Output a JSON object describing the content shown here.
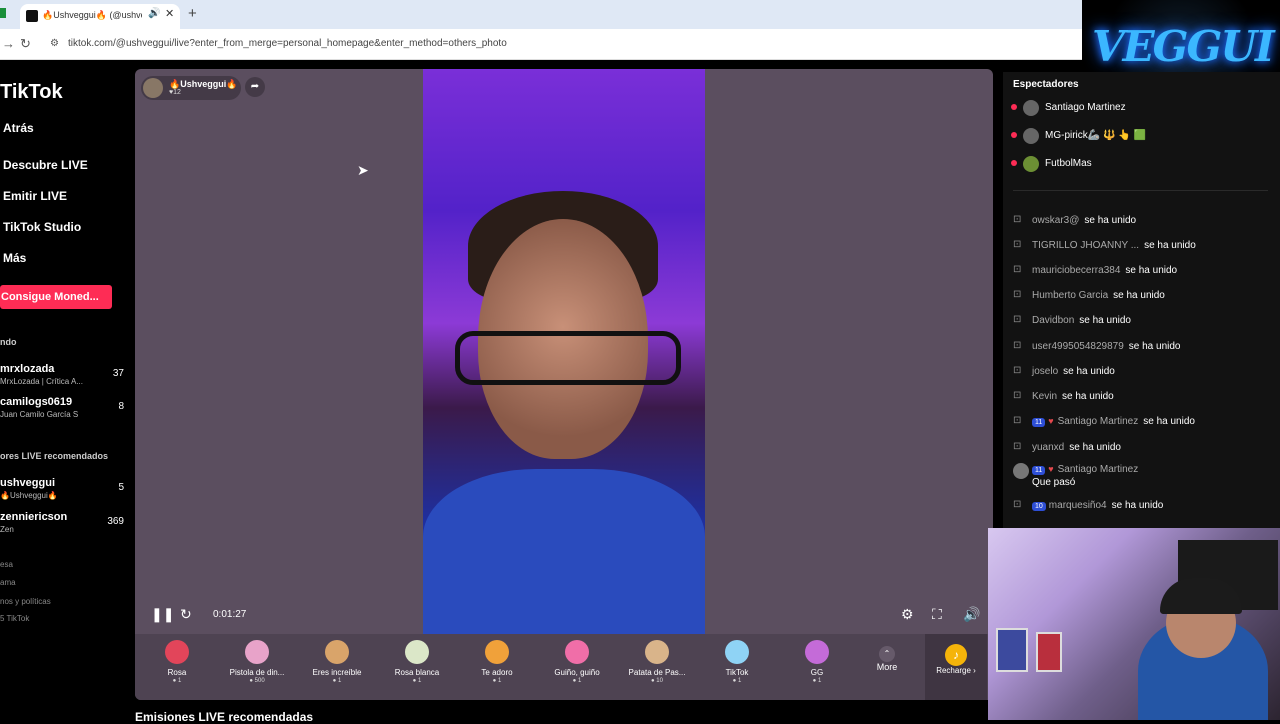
{
  "browser": {
    "tab_title": "🔥Ushveggui🔥 (@ushveg",
    "new_tab": "+",
    "close": "✕",
    "url": "tiktok.com/@ushveggui/live?enter_from_merge=personal_homepage&enter_method=others_photo"
  },
  "overlay_logo": "VEGGUI",
  "sidebar": {
    "brand": "TikTok",
    "nav": [
      "Atrás",
      "Descubre LIVE",
      "Emitir LIVE",
      "TikTok Studio",
      "Más"
    ],
    "coins_button": "Consigue Moned...",
    "following_label": "ndo",
    "following": [
      {
        "name": "mrxlozada",
        "sub": "MrxLozada | Crítica A...",
        "count": "37"
      },
      {
        "name": "camilogs0619",
        "sub": "Juan Camilo García S",
        "count": "8"
      }
    ],
    "recommended_label": "ores LIVE recomendados",
    "recommended": [
      {
        "name": "ushveggui",
        "sub": "🔥Ushveggui🔥",
        "count": "5"
      },
      {
        "name": "zenniericson",
        "sub": "Zen",
        "count": "369"
      }
    ],
    "footer": [
      "esa",
      "ama",
      "nos y políticas",
      "5 TikTok"
    ]
  },
  "player": {
    "streamer_name": "🔥Ushveggui🔥",
    "likes": "♥12",
    "elapsed": "0:01:27",
    "gifts": [
      {
        "name": "Rosa",
        "price": "1",
        "color": "#e2455a"
      },
      {
        "name": "Pistola de din...",
        "price": "500",
        "color": "#e8a3c9"
      },
      {
        "name": "Eres increíble",
        "price": "1",
        "color": "#d9a46a"
      },
      {
        "name": "Rosa blanca",
        "price": "1",
        "color": "#dbe7c8"
      },
      {
        "name": "Te adoro",
        "price": "1",
        "color": "#f0a13a"
      },
      {
        "name": "Guiño, guiño",
        "price": "1",
        "color": "#f06ea8"
      },
      {
        "name": "Patata de Pas...",
        "price": "10",
        "color": "#d9b48a"
      },
      {
        "name": "TikTok",
        "price": "1",
        "color": "#8fd3f5"
      },
      {
        "name": "GG",
        "price": "1",
        "color": "#c46bd8"
      }
    ],
    "more_label": "More",
    "recharge_label": "Recharge ›"
  },
  "recommendations_heading": "Emisiones LIVE recomendadas",
  "chat": {
    "viewers_heading": "Espectadores",
    "viewers": [
      {
        "rank": "1",
        "name": "Santiago Martinez"
      },
      {
        "rank": "2",
        "name": "MG-pirick🦾 🔱 👆 🟩"
      },
      {
        "rank": "3",
        "name": "FutbolMas"
      }
    ],
    "joined_text": "se ha unido",
    "joins": [
      "owskar3@",
      "TIGRILLO JHOANNY ...",
      "mauriciobecerra384",
      "Humberto Garcia",
      "Davidbon",
      "user4995054829879",
      "joselo",
      "Kevin"
    ],
    "join_badged": {
      "badge": "11",
      "name": "Santiago Martinez"
    },
    "join_after": "yuanxd",
    "comment": {
      "badge": "11",
      "name": "Santiago Martinez",
      "text": "Que pasó"
    },
    "last_join": {
      "badge": "10",
      "name": "marquesiño4"
    }
  }
}
